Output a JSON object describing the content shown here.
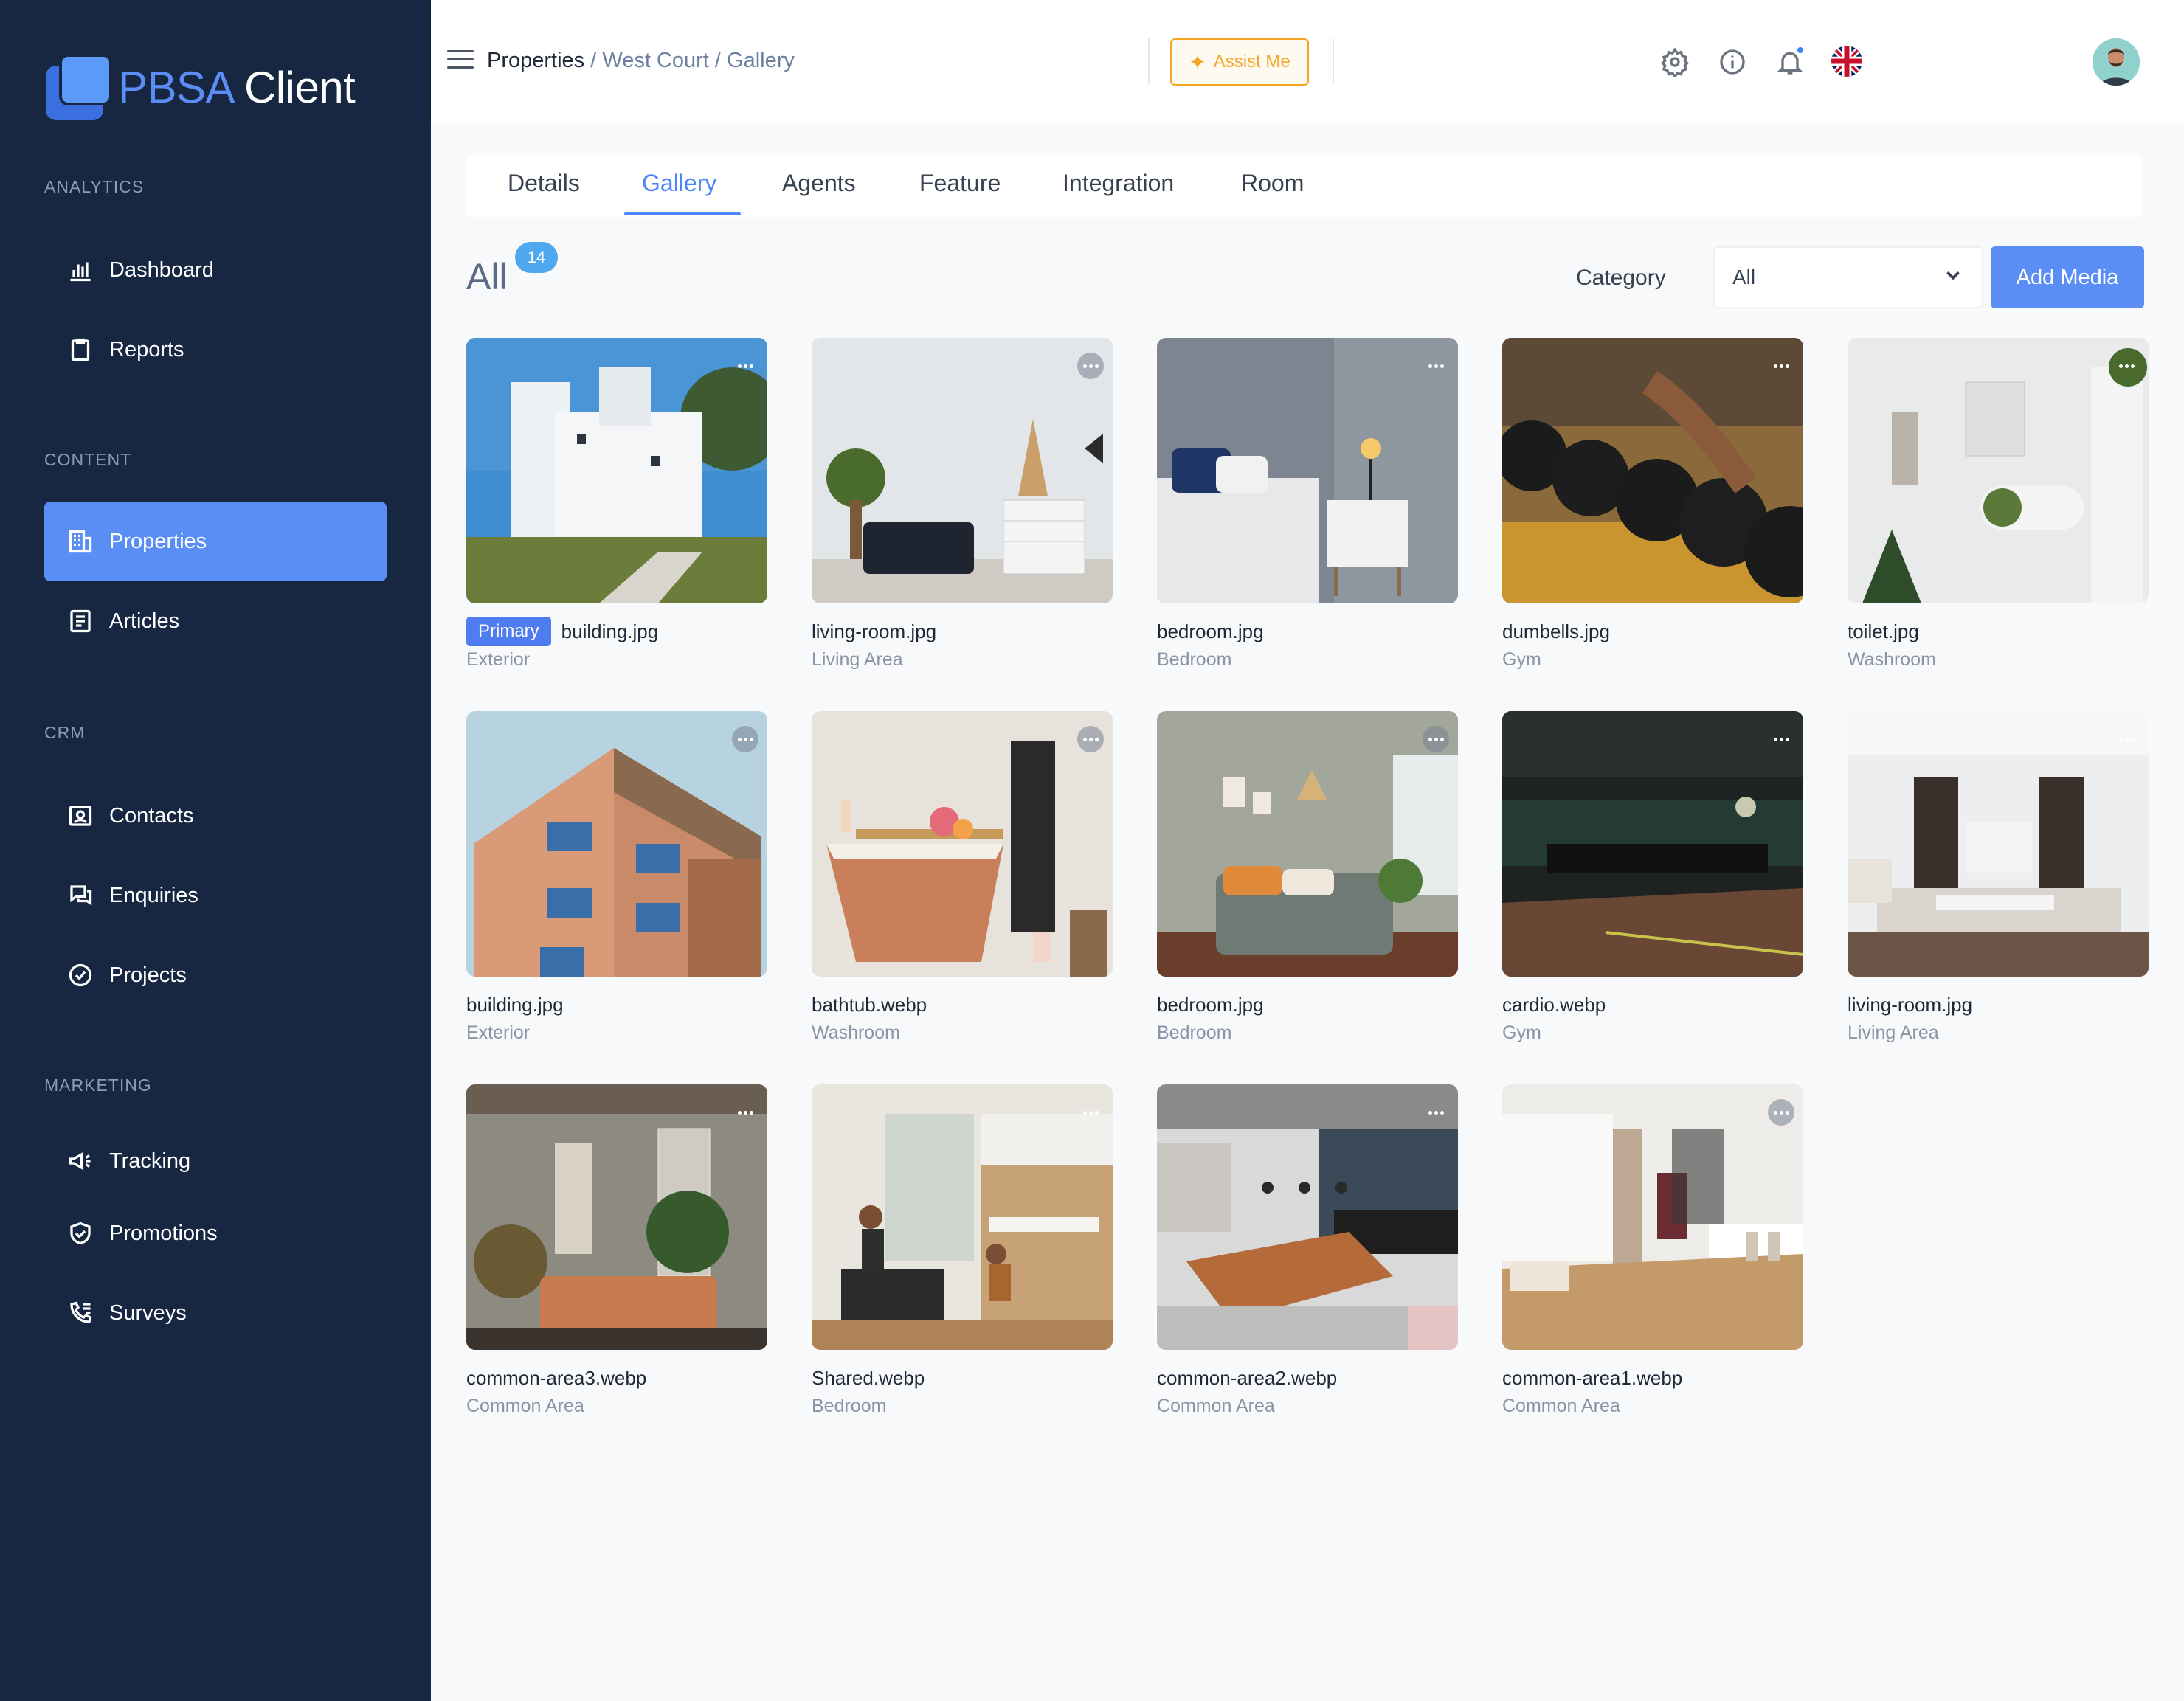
{
  "app": {
    "logo_part1": "PBSA",
    "logo_part2": "Client"
  },
  "sidebar": {
    "sections": [
      {
        "title": "ANALYTICS"
      },
      {
        "title": "CONTENT"
      },
      {
        "title": "CRM"
      },
      {
        "title": "MARKETING"
      }
    ],
    "items": [
      {
        "label": "Dashboard",
        "icon": "bar-chart-icon"
      },
      {
        "label": "Reports",
        "icon": "clipboard-icon"
      },
      {
        "label": "Properties",
        "icon": "building-icon"
      },
      {
        "label": "Articles",
        "icon": "document-icon"
      },
      {
        "label": "Contacts",
        "icon": "contact-card-icon"
      },
      {
        "label": "Enquiries",
        "icon": "chat-icon"
      },
      {
        "label": "Projects",
        "icon": "check-circle-icon"
      },
      {
        "label": "Tracking",
        "icon": "megaphone-icon"
      },
      {
        "label": "Promotions",
        "icon": "shield-check-icon"
      },
      {
        "label": "Surveys",
        "icon": "phone-list-icon"
      }
    ],
    "active_item": "Properties",
    "accent": "#5b8ef5",
    "background": "#172641"
  },
  "header": {
    "breadcrumb": {
      "first": "Properties",
      "rest": " / West Court / Gallery"
    },
    "assist_label": "Assist Me",
    "assist_color": "#f5a524"
  },
  "tabs": [
    "Details",
    "Gallery",
    "Agents",
    "Feature",
    "Integration",
    "Room"
  ],
  "active_tab": "Gallery",
  "toolbar": {
    "all_label": "All",
    "count": "14",
    "category_label": "Category",
    "category_value": "All",
    "add_label": "Add Media"
  },
  "gallery": {
    "primary_badge": "Primary",
    "items": [
      {
        "file": "building.jpg",
        "category": "Exterior"
      },
      {
        "file": "living-room.jpg",
        "category": "Living Area"
      },
      {
        "file": "bedroom.jpg",
        "category": "Bedroom"
      },
      {
        "file": "dumbells.jpg",
        "category": "Gym"
      },
      {
        "file": "toilet.jpg",
        "category": "Washroom"
      },
      {
        "file": "building.jpg",
        "category": "Exterior"
      },
      {
        "file": "bathtub.webp",
        "category": "Washroom"
      },
      {
        "file": "bedroom.jpg",
        "category": "Bedroom"
      },
      {
        "file": "cardio.webp",
        "category": "Gym"
      },
      {
        "file": "living-room.jpg",
        "category": "Living Area"
      },
      {
        "file": "common-area3.webp",
        "category": "Common Area"
      },
      {
        "file": "Shared.webp",
        "category": "Bedroom"
      },
      {
        "file": "common-area2.webp",
        "category": "Common Area"
      },
      {
        "file": "common-area1.webp",
        "category": "Common Area"
      }
    ]
  }
}
